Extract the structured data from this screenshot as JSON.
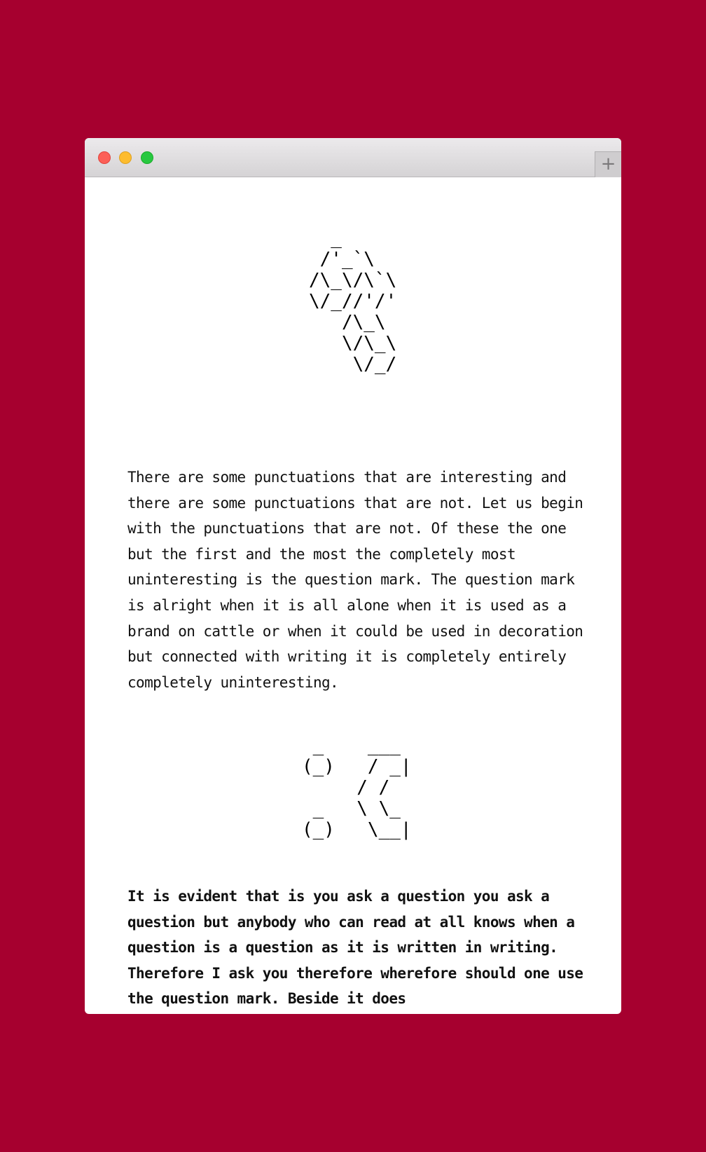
{
  "window": {
    "new_tab_symbol": "+",
    "traffic_lights": {
      "close_color": "#fc5f57",
      "minimize_color": "#fdbc2e",
      "zoom_color": "#28c840"
    },
    "background_color": "#a6002f"
  },
  "content": {
    "ascii_art_1": "  _\n /'_`\\\n/\\_\\/\\`\\\n\\/_//'/'\n   /\\_\\\n   \\/\\_\\\n    \\/_/",
    "paragraph_1": "There are some punctuations that are interesting and there are some punctuations that are not. Let us begin with the punctuations that are not. Of these the one but the first and the most the completely most uninteresting is the question mark. The question mark is alright when it is all alone when it is used as a brand on cattle or when it could be used in decoration but connected with writing it is completely entirely completely uninteresting.",
    "ascii_art_2": " _    ___\n(_)   / _|\n     / /\n _   \\ \\_\n(_)   \\__|",
    "paragraph_2": "It is evident that is you ask a question you ask a question but anybody who can read at all knows when a question is a question as it is written in writing. Therefore I ask you therefore wherefore should one use the question mark. Beside it does"
  }
}
